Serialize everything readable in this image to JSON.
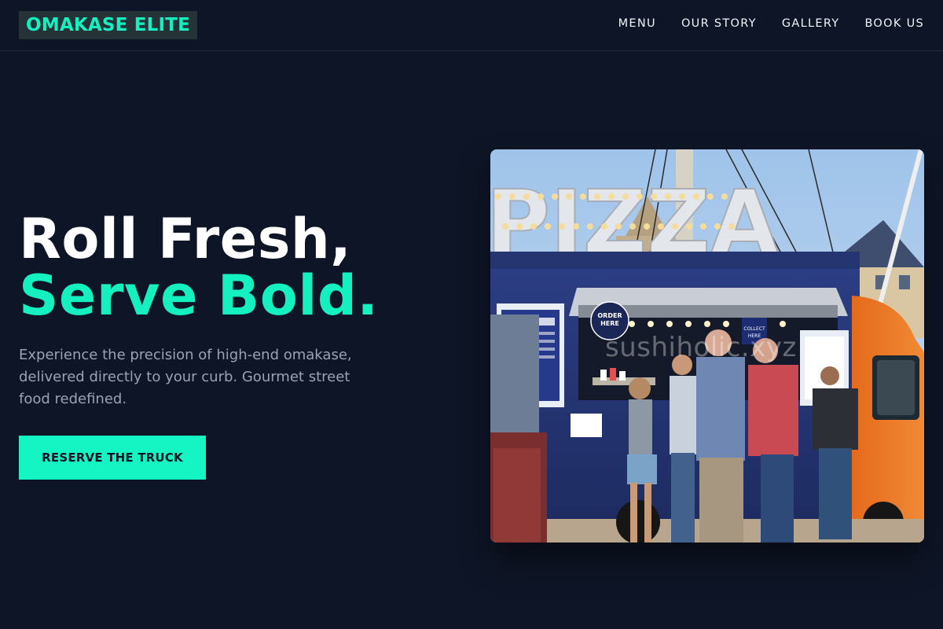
{
  "brand": {
    "name": "OMAKASE ELITE"
  },
  "nav": {
    "items": [
      {
        "label": "MENU"
      },
      {
        "label": "OUR STORY"
      },
      {
        "label": "GALLERY"
      },
      {
        "label": "BOOK US"
      }
    ]
  },
  "hero": {
    "headline_line1": "Roll Fresh,",
    "headline_line2": "Serve Bold.",
    "description": "Experience the precision of high-end omakase, delivered directly to your curb. Gourmet street food redefined.",
    "cta_label": "RESERVE THE TRUCK",
    "image": {
      "sign_text": "PIZZA",
      "order_badge": "ORDER HERE",
      "collect_badge": "COLLECT HERE",
      "watermark": "sushiholic.xyz"
    }
  },
  "colors": {
    "background": "#0e1526",
    "accent": "#14f0c0",
    "text_muted": "#9aa3b2"
  }
}
